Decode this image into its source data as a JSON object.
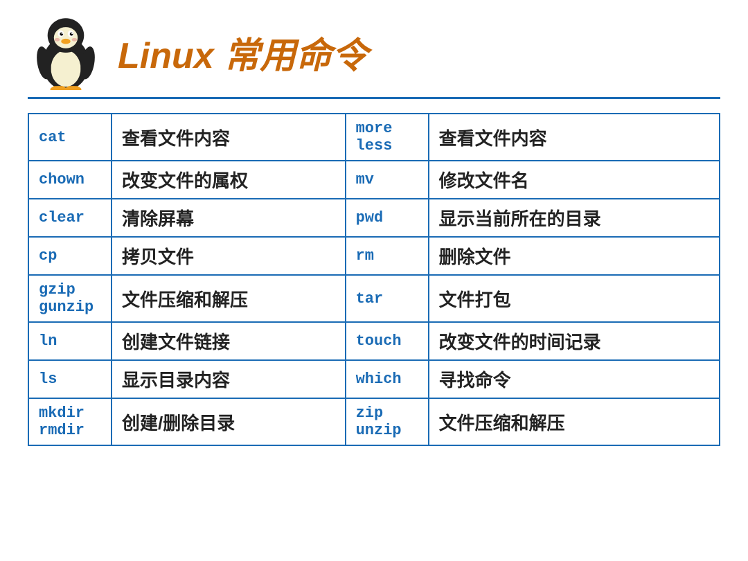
{
  "header": {
    "title": "Linux 常用命令"
  },
  "table": {
    "rows": [
      {
        "cmd1": "cat",
        "desc1": "查看文件内容",
        "cmd2": "more\nless",
        "desc2": "查看文件内容"
      },
      {
        "cmd1": "chown",
        "desc1": "改变文件的属权",
        "cmd2": "mv",
        "desc2": "修改文件名"
      },
      {
        "cmd1": "clear",
        "desc1": "清除屏幕",
        "cmd2": "pwd",
        "desc2": "显示当前所在的目录"
      },
      {
        "cmd1": "cp",
        "desc1": "拷贝文件",
        "cmd2": "rm",
        "desc2": "删除文件"
      },
      {
        "cmd1": "gzip\ngunzip",
        "desc1": "文件压缩和解压",
        "cmd2": "tar",
        "desc2": "文件打包"
      },
      {
        "cmd1": "ln",
        "desc1": "创建文件链接",
        "cmd2": "touch",
        "desc2": "改变文件的时间记录"
      },
      {
        "cmd1": "ls",
        "desc1": "显示目录内容",
        "cmd2": "which",
        "desc2": "寻找命令"
      },
      {
        "cmd1": "mkdir\nrmdir",
        "desc1": "创建/删除目录",
        "cmd2": "zip\nunzip",
        "desc2": "文件压缩和解压"
      }
    ]
  }
}
